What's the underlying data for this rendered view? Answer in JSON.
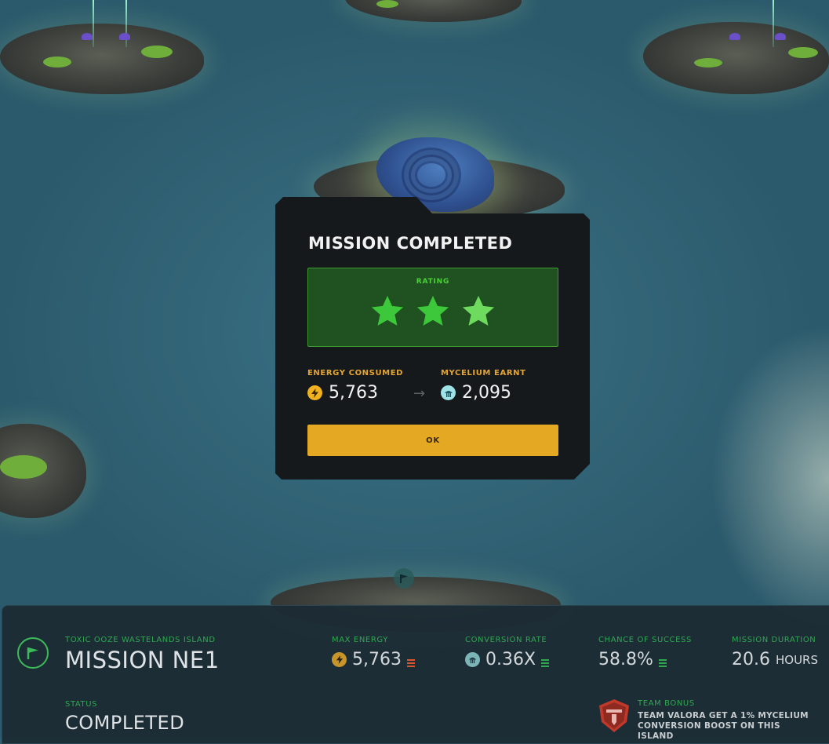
{
  "modal": {
    "title": "MISSION COMPLETED",
    "rating_label": "RATING",
    "rating_stars": 3,
    "rating_max": 3,
    "energy_label": "ENERGY CONSUMED",
    "energy_value": "5,763",
    "mycelium_label": "MYCELIUM EARNT",
    "mycelium_value": "2,095",
    "arrow_icon": "arrow-right-icon",
    "ok_label": "OK"
  },
  "mission": {
    "island": "TOXIC OOZE WASTELANDS ISLAND",
    "name": "MISSION NE1",
    "status_label": "STATUS",
    "status": "COMPLETED",
    "max_energy_label": "MAX ENERGY",
    "max_energy": "5,763",
    "conversion_label": "CONVERSION RATE",
    "conversion": "0.36X",
    "success_label": "CHANCE OF SUCCESS",
    "success": "58.8%",
    "duration_label": "MISSION DURATION",
    "duration_value": "20.6",
    "duration_unit": "HOURS",
    "team_bonus_label": "TEAM BONUS",
    "team_bonus_text": "TEAM VALORA GET A 1% MYCELIUM CONVERSION BOOST ON THIS ISLAND"
  },
  "colors": {
    "accent_green": "#2fa850",
    "star_green": "#3cc83a",
    "energy_yellow": "#f0b21f",
    "button_yellow": "#e5a822",
    "warning_red": "#d9542f"
  }
}
